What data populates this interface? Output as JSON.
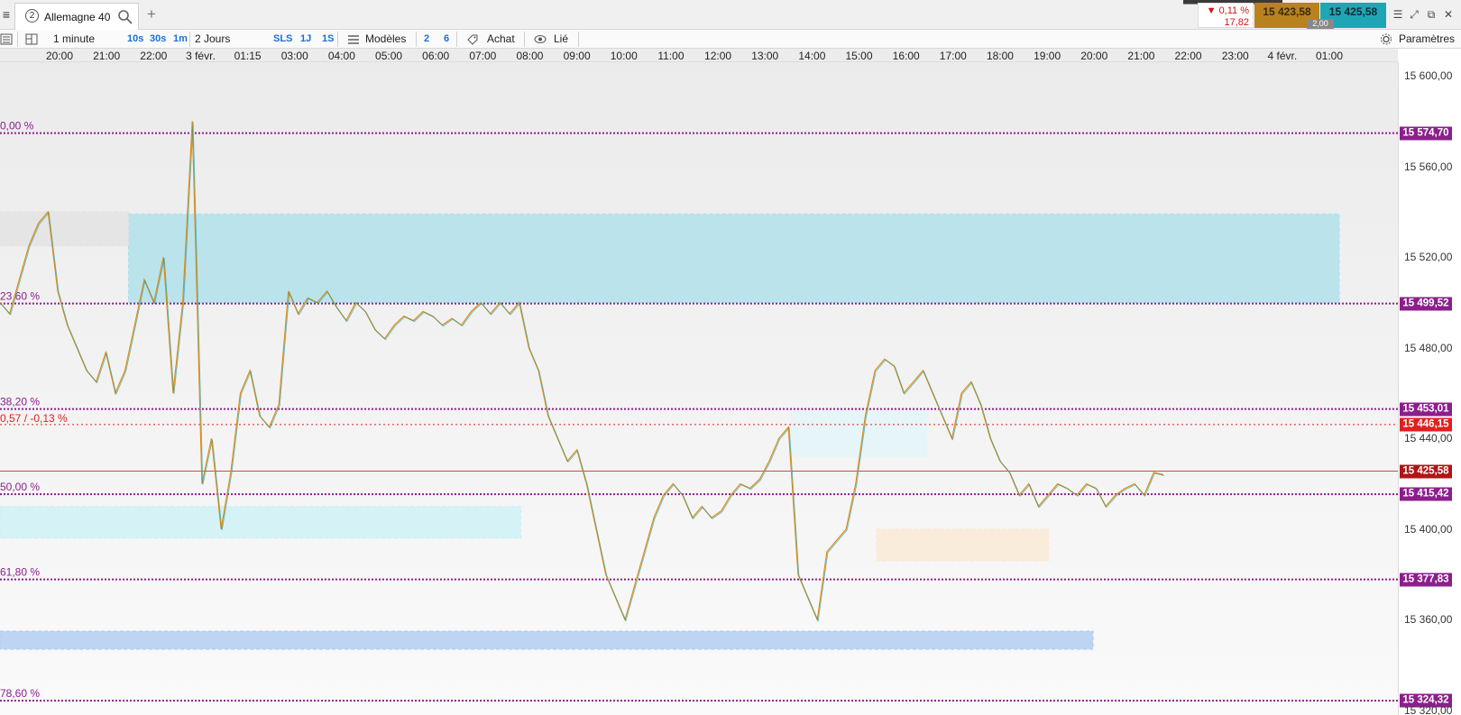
{
  "topbar": {
    "menu_icon": "hamburger-icon",
    "instrument_number": "2",
    "instrument_name": "Allemagne 40",
    "search_icon": "search-icon",
    "add_tab": "+",
    "change_pct": "▼ 0,11 %",
    "change_abs": "17,82",
    "bid": "15 423,58",
    "ask": "15 425,58",
    "spread": "2,00",
    "colors": {
      "bid": "#b8821f",
      "ask": "#1fa6b4",
      "down": "#d21414"
    }
  },
  "toolbar": {
    "timeframe": "1 minute",
    "quick_tf": [
      "10s",
      "30s",
      "1m"
    ],
    "range": "2 Jours",
    "sls": "SLS",
    "range_buttons": [
      "1J",
      "1S"
    ],
    "models": "Modèles",
    "counts": [
      "2",
      "6"
    ],
    "buy": "Achat",
    "linked": "Lié",
    "settings": "Paramètres"
  },
  "chart_data": {
    "type": "line",
    "title": "",
    "xlabel": "",
    "ylabel": "",
    "x_ticks": [
      "20:00",
      "21:00",
      "22:00",
      "3 févr.",
      "01:15",
      "03:00",
      "04:00",
      "05:00",
      "06:00",
      "07:00",
      "08:00",
      "09:00",
      "10:00",
      "11:00",
      "12:00",
      "13:00",
      "14:00",
      "15:00",
      "16:00",
      "17:00",
      "18:00",
      "19:00",
      "20:00",
      "21:00",
      "22:00",
      "23:00",
      "4 févr.",
      "01:00"
    ],
    "ylim": [
      15318,
      15606
    ],
    "y_ticks": [
      "15 600,00",
      "15 560,00",
      "15 520,00",
      "15 480,00",
      "15 440,00",
      "15 400,00",
      "15 360,00",
      "15 320,00"
    ],
    "grid": false,
    "series": [
      {
        "values": [
          15500,
          15495,
          15510,
          15525,
          15535,
          15540,
          15505,
          15490,
          15480,
          15470,
          15465,
          15478,
          15460,
          15470,
          15490,
          15510,
          15500,
          15520,
          15460,
          15500,
          15580,
          15420,
          15440,
          15400,
          15425,
          15460,
          15470,
          15450,
          15445,
          15455,
          15505,
          15495,
          15502,
          15500,
          15505,
          15498,
          15492,
          15500,
          15496,
          15488,
          15484,
          15490,
          15494,
          15492,
          15496,
          15494,
          15490,
          15493,
          15490,
          15496,
          15500,
          15495,
          15500,
          15495,
          15500,
          15480,
          15470,
          15450,
          15440,
          15430,
          15435,
          15420,
          15400,
          15380,
          15370,
          15360,
          15375,
          15390,
          15405,
          15415,
          15420,
          15415,
          15405,
          15410,
          15405,
          15408,
          15415,
          15420,
          15418,
          15422,
          15430,
          15440,
          15445,
          15380,
          15370,
          15360,
          15390,
          15395,
          15400,
          15420,
          15450,
          15470,
          15475,
          15472,
          15460,
          15465,
          15470,
          15460,
          15450,
          15440,
          15460,
          15465,
          15455,
          15440,
          15430,
          15425,
          15415,
          15420,
          15410,
          15415,
          15420,
          15418,
          15415,
          15420,
          15418,
          15410,
          15415,
          15418,
          15420,
          15415,
          15425,
          15424
        ]
      }
    ],
    "levels": [
      {
        "label": "0,00 %",
        "price": "15 574,70",
        "value": 15574.7,
        "color": "#8b1f8b"
      },
      {
        "label": "23,60 %",
        "price": "15 499,52",
        "value": 15499.52,
        "color": "#8b1f8b"
      },
      {
        "label": "38,20 %",
        "price": "15 453,01",
        "value": 15453.01,
        "color": "#8b1f8b"
      },
      {
        "label": "50,00 %",
        "price": "15 415,42",
        "value": 15415.42,
        "color": "#8b1f8b"
      },
      {
        "label": "61,80 %",
        "price": "15 377,83",
        "value": 15377.83,
        "color": "#8b1f8b"
      },
      {
        "label": "78,60 %",
        "price": "15 324,32",
        "value": 15324.32,
        "color": "#8b1f8b"
      }
    ],
    "alert_line": {
      "label": "0,57 / -0,13 %",
      "price": "15 446,15",
      "value": 15446.15,
      "color": "#e02020"
    },
    "last_price": {
      "price": "15 425,58",
      "value": 15425.58,
      "color": "#b01515"
    },
    "zones": [
      {
        "x0": 0.095,
        "x1": 0.99,
        "y0": 15500,
        "y1": 15539,
        "color": "#a8dfea"
      },
      {
        "x0": 0.0,
        "x1": 0.385,
        "y0": 15396,
        "y1": 15410,
        "color": "#c9f0f6"
      },
      {
        "x0": 0.0,
        "x1": 0.808,
        "y0": 15347,
        "y1": 15355,
        "color": "#a9c9f2"
      },
      {
        "x0": 0.585,
        "x1": 0.685,
        "y0": 15432,
        "y1": 15452,
        "color": "#e1f5f8"
      },
      {
        "x0": 0.648,
        "x1": 0.775,
        "y0": 15386,
        "y1": 15400,
        "color": "#fbe8d2"
      },
      {
        "x0": 0.0,
        "x1": 0.095,
        "y0": 15525,
        "y1": 15540,
        "color": "#e2e2e2"
      }
    ]
  }
}
